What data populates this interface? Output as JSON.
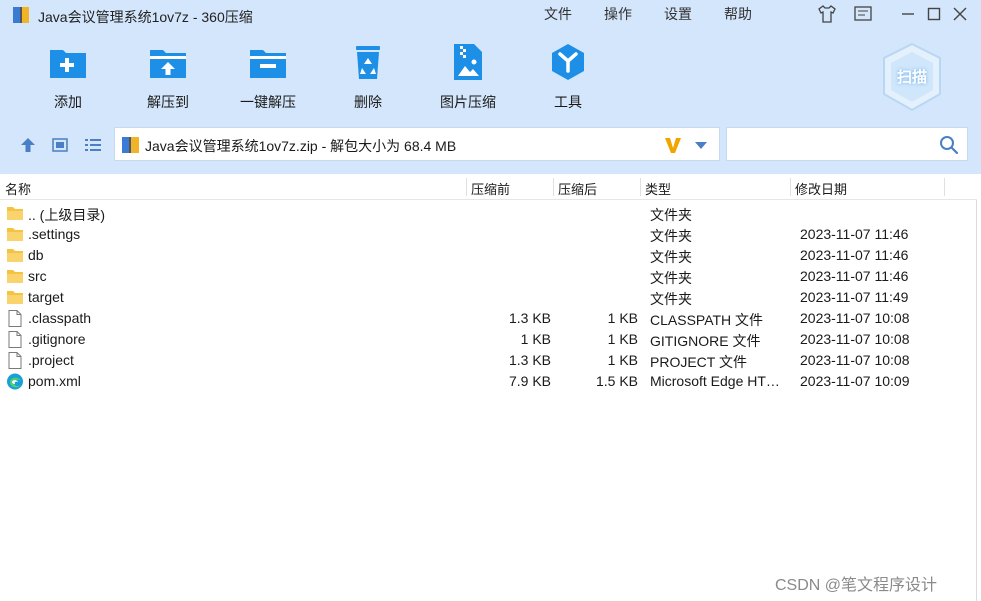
{
  "window": {
    "title": "Java会议管理系统1ov7z - 360压缩"
  },
  "menu": {
    "items": [
      "文件",
      "操作",
      "设置",
      "帮助"
    ]
  },
  "toolbar": {
    "items": [
      {
        "label": "添加",
        "icon": "add-folder-icon"
      },
      {
        "label": "解压到",
        "icon": "extract-to-icon"
      },
      {
        "label": "一键解压",
        "icon": "one-click-extract-icon"
      },
      {
        "label": "删除",
        "icon": "recycle-bin-icon"
      },
      {
        "label": "图片压缩",
        "icon": "image-compress-icon"
      },
      {
        "label": "工具",
        "icon": "tools-icon"
      }
    ],
    "scan_label": "扫描"
  },
  "address": {
    "path": "Java会议管理系统1ov7z.zip - 解包大小为 68.4 MB"
  },
  "search": {
    "placeholder": "",
    "value": ""
  },
  "columns": {
    "name": "名称",
    "compressed": "压缩前",
    "original": "压缩后",
    "type": "类型",
    "modified": "修改日期"
  },
  "files": [
    {
      "name": ".. (上级目录)",
      "compressed": "",
      "original": "",
      "type": "文件夹",
      "modified": "",
      "icon": "folder-icon"
    },
    {
      "name": ".settings",
      "compressed": "",
      "original": "",
      "type": "文件夹",
      "modified": "2023-11-07 11:46",
      "icon": "folder-icon"
    },
    {
      "name": "db",
      "compressed": "",
      "original": "",
      "type": "文件夹",
      "modified": "2023-11-07 11:46",
      "icon": "folder-icon"
    },
    {
      "name": "src",
      "compressed": "",
      "original": "",
      "type": "文件夹",
      "modified": "2023-11-07 11:46",
      "icon": "folder-icon"
    },
    {
      "name": "target",
      "compressed": "",
      "original": "",
      "type": "文件夹",
      "modified": "2023-11-07 11:49",
      "icon": "folder-icon"
    },
    {
      "name": ".classpath",
      "compressed": "1.3 KB",
      "original": "1 KB",
      "type": "CLASSPATH 文件",
      "modified": "2023-11-07 10:08",
      "icon": "file-icon"
    },
    {
      "name": ".gitignore",
      "compressed": "1 KB",
      "original": "1 KB",
      "type": "GITIGNORE 文件",
      "modified": "2023-11-07 10:08",
      "icon": "file-icon"
    },
    {
      "name": ".project",
      "compressed": "1.3 KB",
      "original": "1 KB",
      "type": "PROJECT 文件",
      "modified": "2023-11-07 10:08",
      "icon": "file-icon"
    },
    {
      "name": "pom.xml",
      "compressed": "7.9 KB",
      "original": "1.5 KB",
      "type": "Microsoft Edge HT…",
      "modified": "2023-11-07 10:09",
      "icon": "edge-icon"
    }
  ],
  "watermark": "CSDN @笔文程序设计",
  "colors": {
    "toolbar_bg": "#d4e6fb",
    "accent": "#1e8fe6",
    "folder": "#f5c242"
  }
}
